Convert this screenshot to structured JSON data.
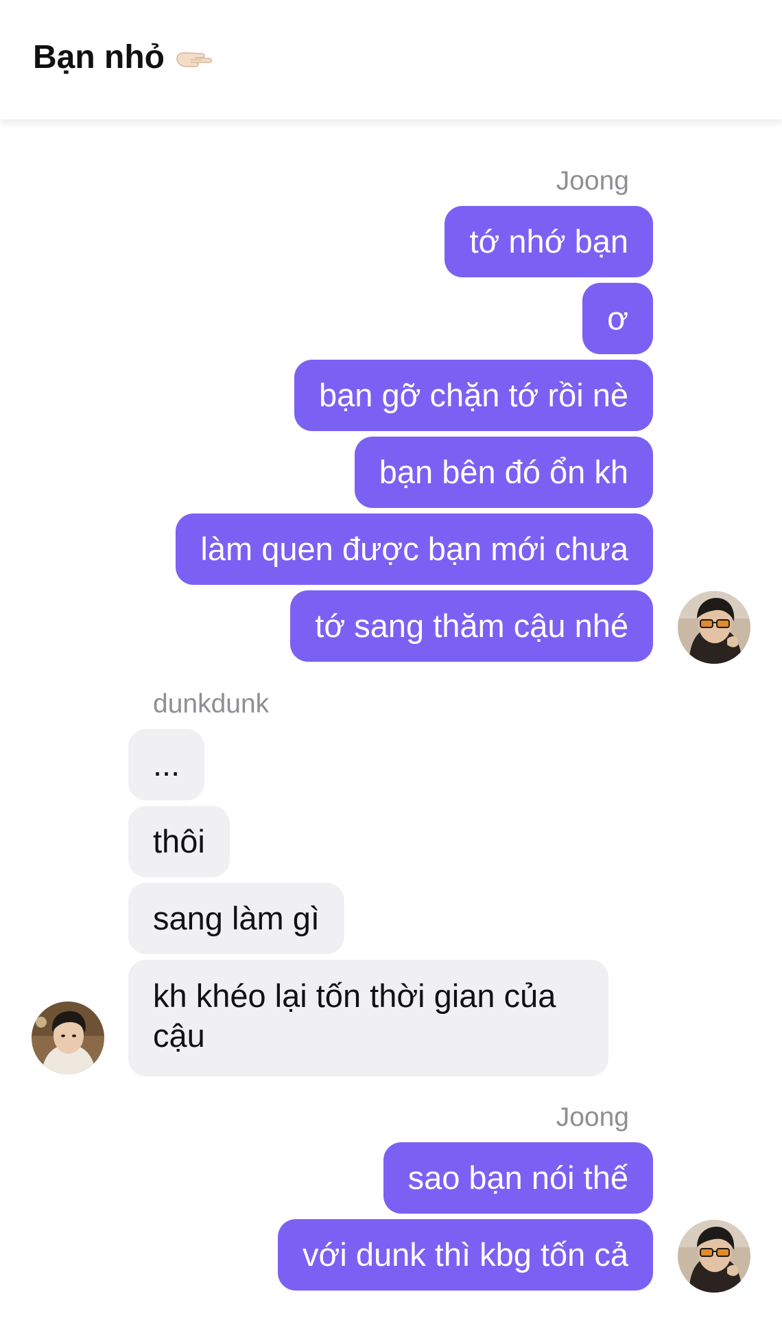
{
  "header": {
    "title": "Bạn nhỏ",
    "title_icon": "pointing-hand-icon"
  },
  "colors": {
    "outgoing_bubble": "#7b61f3",
    "incoming_bubble": "#f0f0f2",
    "sender_label": "#8e8e93"
  },
  "groups": [
    {
      "sender": "Joong",
      "direction": "outgoing",
      "messages": [
        "tớ nhớ bạn",
        "ơ",
        "bạn gỡ chặn tớ rồi nè",
        "bạn bên đó ổn kh",
        "làm quen được bạn mới chưa",
        "tớ sang thăm cậu nhé"
      ]
    },
    {
      "sender": "dunkdunk",
      "direction": "incoming",
      "messages": [
        "...",
        "thôi",
        "sang làm gì",
        "kh khéo lại tốn thời gian của cậu"
      ]
    },
    {
      "sender": "Joong",
      "direction": "outgoing",
      "messages": [
        "sao bạn nói thế",
        "với dunk thì kbg tốn cả"
      ]
    }
  ]
}
